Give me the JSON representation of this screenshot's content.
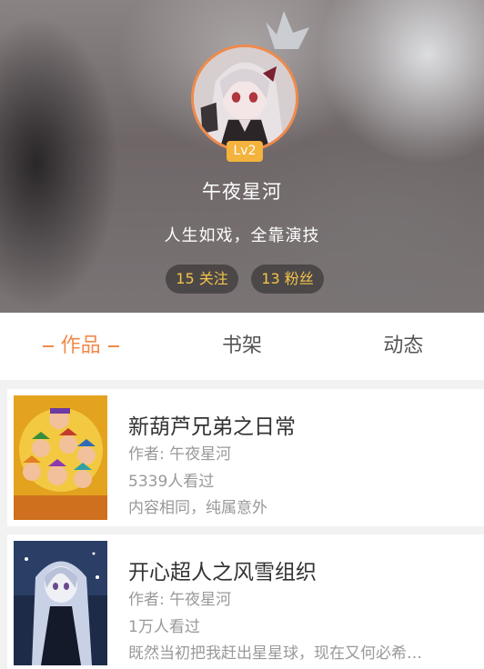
{
  "profile": {
    "level": "Lv2",
    "username": "午夜星河",
    "signature": "人生如戏，全靠演技",
    "follow_count": "15 关注",
    "fans_count": "13 粉丝"
  },
  "tabs": [
    {
      "label": "作品",
      "active": true
    },
    {
      "label": "书架",
      "active": false
    },
    {
      "label": "动态",
      "active": false
    }
  ],
  "works": [
    {
      "title": "新葫芦兄弟之日常",
      "author": "作者: 午夜星河",
      "views": "5339人看过",
      "description": "内容相同，纯属意外"
    },
    {
      "title": "开心超人之风雪组织",
      "author": "作者: 午夜星河",
      "views": "1万人看过",
      "description": "既然当初把我赶出星星球，现在又何必希…"
    }
  ],
  "colors": {
    "accent": "#f08a4b",
    "level_badge": "#f3b33d",
    "stat_text": "#f3c54a"
  }
}
